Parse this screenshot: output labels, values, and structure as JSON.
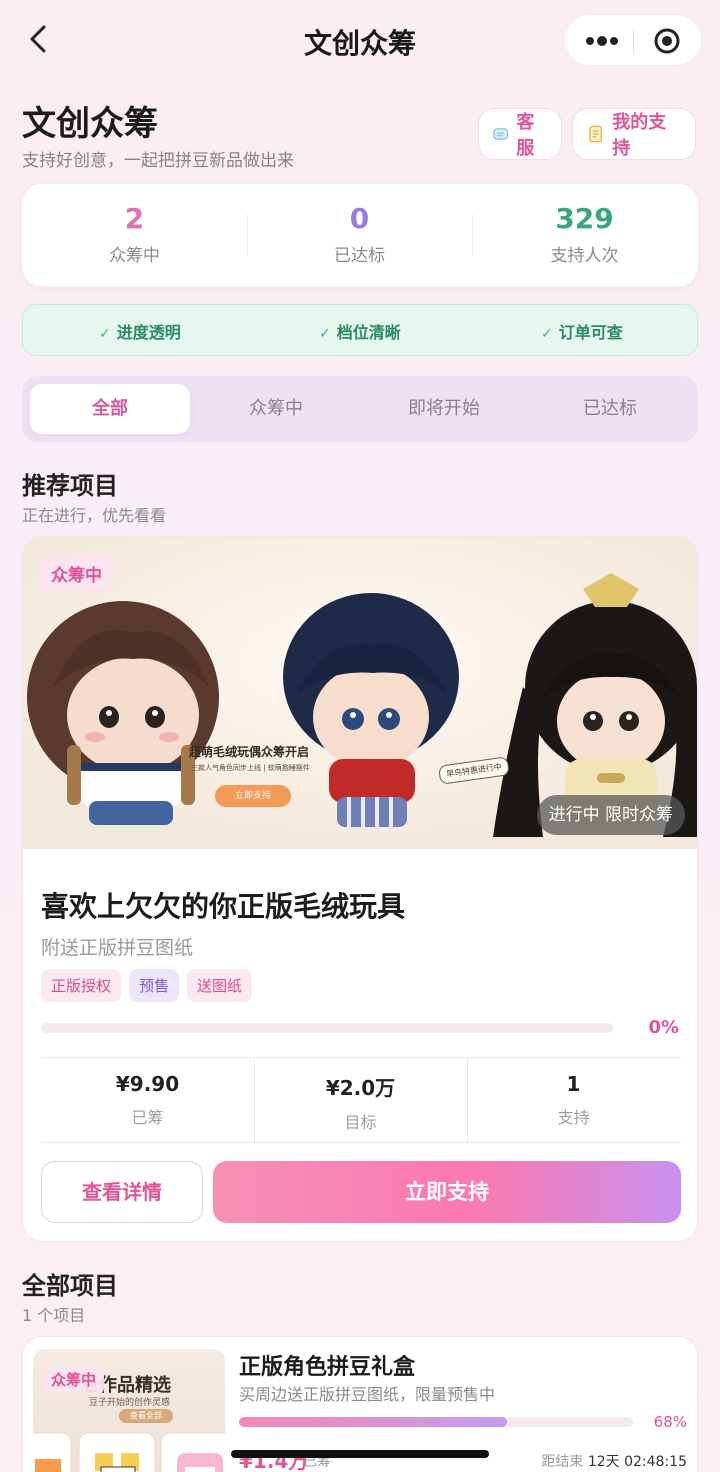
{
  "nav": {
    "title": "文创众筹"
  },
  "header": {
    "title": "文创众筹",
    "subtitle": "支持好创意，一起把拼豆新品做出来",
    "service_label": "客服",
    "my_support_label": "我的支持"
  },
  "stats": [
    {
      "value": "2",
      "label": "众筹中",
      "color": "#e070b0"
    },
    {
      "value": "0",
      "label": "已达标",
      "color": "#9a7ae0"
    },
    {
      "value": "329",
      "label": "支持人次",
      "color": "#3aa67a"
    }
  ],
  "features": [
    "进度透明",
    "档位清晰",
    "订单可查"
  ],
  "tabs": [
    "全部",
    "众筹中",
    "即将开始",
    "已达标"
  ],
  "recommended": {
    "title": "推荐项目",
    "subtitle": "正在进行，优先看看"
  },
  "featured": {
    "badge": "众筹中",
    "status": "进行中  限时众筹",
    "banner_headline": "超萌毛绒玩偶众筹开启",
    "banner_sub": "三款人气角色同步上线 | 软萌抱睡摆件",
    "banner_button": "立即支持",
    "banner_tag": "早鸟特惠进行中",
    "title": "喜欢上欠欠的你正版毛绒玩具",
    "subtitle": "附送正版拼豆图纸",
    "tags": [
      "正版授权",
      "预售",
      "送图纸"
    ],
    "progress_percent": 0,
    "progress_label": "0%",
    "metrics": [
      {
        "value": "¥9.90",
        "label": "已筹"
      },
      {
        "value": "¥2.0万",
        "label": "目标"
      },
      {
        "value": "1",
        "label": "支持"
      }
    ],
    "details_button": "查看详情",
    "support_button": "立即支持"
  },
  "all_projects": {
    "title": "全部项目",
    "count": "1 个项目"
  },
  "project_list": [
    {
      "badge": "众筹中",
      "thumb_title": "豆作品精选",
      "thumb_sub": "豆子开始的创作灵感",
      "thumb_link": "查看全部",
      "title": "正版角色拼豆礼盒",
      "subtitle": "买周边送正版拼豆图纸，限量预售中",
      "progress_percent": 68,
      "progress_label": "68%",
      "raised": "¥1.4万",
      "raised_label": "已筹",
      "end_prefix": "距结束",
      "end_time": "12天 02:48:15"
    }
  ]
}
